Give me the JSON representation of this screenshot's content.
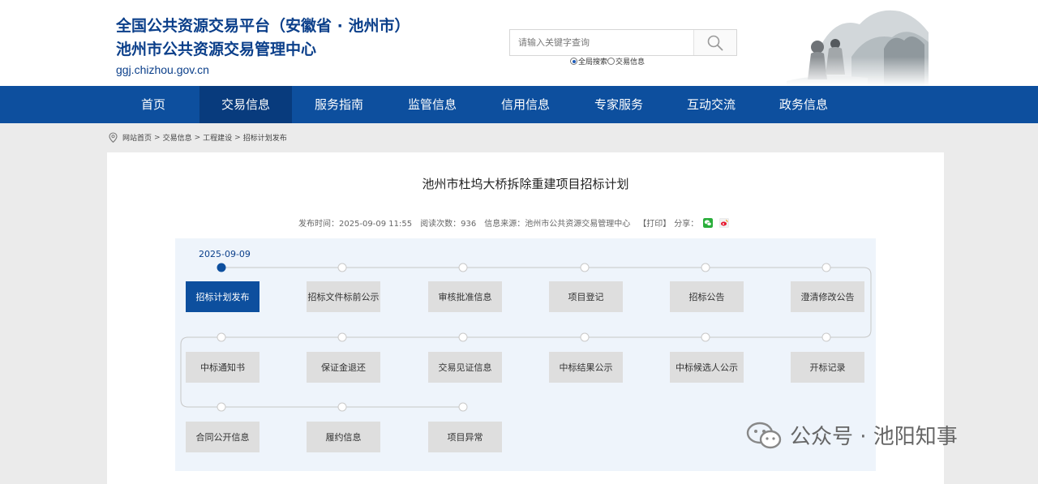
{
  "header": {
    "title_line1": "全国公共资源交易平台（安徽省 · 池州市）",
    "title_line2": "池州市公共资源交易管理中心",
    "domain": "ggj.chizhou.gov.cn",
    "search_placeholder": "请输入关键字查询",
    "radio_options": [
      {
        "label": "全局搜索",
        "checked": true
      },
      {
        "label": "交易信息",
        "checked": false
      }
    ]
  },
  "nav": {
    "items": [
      "首页",
      "交易信息",
      "服务指南",
      "监管信息",
      "信用信息",
      "专家服务",
      "互动交流",
      "政务信息"
    ],
    "active": "交易信息"
  },
  "breadcrumb": [
    "网站首页",
    "交易信息",
    "工程建设",
    "招标计划发布"
  ],
  "article": {
    "title": "池州市杜坞大桥拆除重建项目招标计划",
    "publish_time": "发布时间：2025-09-09 11:55",
    "read_count": "阅读次数：936",
    "source": "信息来源：池州市公共资源交易管理中心",
    "print": "【打印】",
    "share": "分享："
  },
  "flow": {
    "date": "2025-09-09",
    "steps": [
      "招标计划发布",
      "招标文件标前公示",
      "审核批准信息",
      "项目登记",
      "招标公告",
      "澄清修改公告",
      "中标通知书",
      "保证金退还",
      "交易见证信息",
      "中标结果公示",
      "中标候选人公示",
      "开标记录",
      "合同公开信息",
      "履约信息",
      "项目异常"
    ],
    "active_index": 0
  },
  "watermark": "公众号 · 池阳知事",
  "colors": {
    "primary": "#0d4f9e",
    "nav_active": "#083b7d",
    "step_bg": "#dedede",
    "flow_bg": "#eef4fb"
  }
}
